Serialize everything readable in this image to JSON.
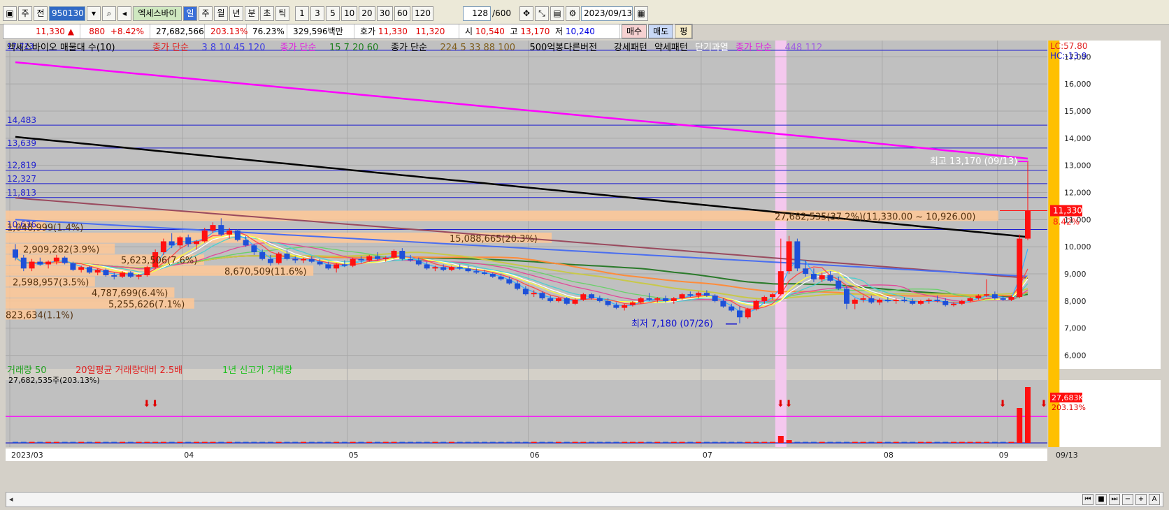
{
  "toolbar": {
    "btn_main": "주",
    "btn_prev": "전",
    "code": "950130",
    "stock_name": "엑세스바이",
    "period_tabs": [
      "일",
      "주",
      "월",
      "년",
      "분",
      "초",
      "틱"
    ],
    "period_selected": "일",
    "intervals": [
      "1",
      "3",
      "5",
      "10",
      "20",
      "30",
      "60",
      "120"
    ],
    "count": "128",
    "count_total": "/600",
    "date": "2023/09/13"
  },
  "quote": {
    "price": "11,330",
    "arrow": "▲",
    "change": "880",
    "change_pct": "+8.42%",
    "volume": "27,682,566",
    "vol_ratio": "203.13%",
    "turnover": "76.23%",
    "amount": "329,596백만",
    "hoga_label": "호가",
    "ask": "11,330",
    "bid": "11,320",
    "open_label": "시",
    "open": "10,540",
    "high_label": "고",
    "high": "13,170",
    "low_label": "저",
    "low": "10,240",
    "buy": "매수",
    "sell": "매도",
    "avg": "평"
  },
  "legend": {
    "main": "엑세스바이오 매물대 수(10)",
    "ma1_title": "종가 단순",
    "ma1_periods": [
      "3",
      "8",
      "10",
      "45",
      "120"
    ],
    "ma2_title": "종가 단순",
    "ma2_periods": [
      "15",
      "7",
      "20",
      "60"
    ],
    "ma3_title": "종가 단순",
    "ma3_periods": [
      "224",
      "5",
      "33",
      "88",
      "100"
    ],
    "extra1": "500억봉다른버전",
    "extra2": "강세패턴",
    "extra3": "약세패턴",
    "extra4": "단기과열",
    "ma4_title": "종가 단순",
    "ma4_periods": [
      "448",
      "112"
    ],
    "lc": "LC:57.80",
    "hc": "HC:-13.9",
    "top_left_value": "17,713"
  },
  "volume_legend": {
    "title": "거래량",
    "p1": "50",
    "t2": "20일평균 거래량대비 2.5배",
    "t3": "1년 신고가 거래량",
    "current": "27,682,535주(203.13%)",
    "badge_value": "27,683K",
    "badge_pct": "203.13%"
  },
  "chart_data": {
    "type": "candlestick",
    "x_tick_labels": [
      "2023/03",
      "04",
      "05",
      "06",
      "07",
      "08",
      "09",
      "09/13"
    ],
    "y_ticks": [
      6000,
      7000,
      8000,
      9000,
      10000,
      11000,
      12000,
      13000,
      14000,
      15000,
      16000,
      17000
    ],
    "ylim": [
      5500,
      17600
    ],
    "hlines": [
      {
        "label": "14,483",
        "value": 14483
      },
      {
        "label": "13,639",
        "value": 13639
      },
      {
        "label": "12,819",
        "value": 12819
      },
      {
        "label": "12,327",
        "value": 12327
      },
      {
        "label": "11,813",
        "value": 11813
      },
      {
        "label": "10,636",
        "value": 10636
      }
    ],
    "volume_profile": [
      {
        "label": "27,682,535(37.2%)(11,330.00 ~ 10,926.00)",
        "lo": 10926,
        "hi": 11330,
        "frac": 1.0
      },
      {
        "label": "1,048,999(1.4%)",
        "lo": 10522,
        "hi": 10926,
        "frac": 0.04
      },
      {
        "label": "15,088,665(20.3%)",
        "lo": 10118,
        "hi": 10522,
        "frac": 0.55
      },
      {
        "label": "2,909,282(3.9%)",
        "lo": 9714,
        "hi": 10118,
        "frac": 0.11
      },
      {
        "label": "5,623,506(7.6%)",
        "lo": 9310,
        "hi": 9714,
        "frac": 0.2
      },
      {
        "label": "8,670,509(11.6%)",
        "lo": 8906,
        "hi": 9310,
        "frac": 0.31
      },
      {
        "label": "2,598,957(3.5%)",
        "lo": 8502,
        "hi": 8906,
        "frac": 0.09
      },
      {
        "label": "4,787,699(6.4%)",
        "lo": 8098,
        "hi": 8502,
        "frac": 0.17
      },
      {
        "label": "5,255,626(7.1%)",
        "lo": 7694,
        "hi": 8098,
        "frac": 0.19
      },
      {
        "label": "823,634(1.1%)",
        "lo": 7290,
        "hi": 7694,
        "frac": 0.03
      }
    ],
    "high_annotation": "최고 13,170 (09/13)",
    "low_annotation": "최저 7,180 (07/26)",
    "last_price_label": "11,330",
    "last_pct_label": "8.42%",
    "candles": [
      [
        9900,
        10100,
        9500,
        9600
      ],
      [
        9600,
        9700,
        9100,
        9200
      ],
      [
        9200,
        9550,
        9100,
        9450
      ],
      [
        9450,
        9600,
        9300,
        9350
      ],
      [
        9350,
        9500,
        9200,
        9450
      ],
      [
        9450,
        9700,
        9350,
        9600
      ],
      [
        9600,
        9650,
        9350,
        9400
      ],
      [
        9400,
        9450,
        9100,
        9150
      ],
      [
        9150,
        9300,
        9050,
        9250
      ],
      [
        9250,
        9300,
        9000,
        9050
      ],
      [
        9050,
        9200,
        8950,
        9150
      ],
      [
        9150,
        9200,
        8900,
        8950
      ],
      [
        8950,
        9050,
        8800,
        8900
      ],
      [
        8900,
        9100,
        8850,
        9050
      ],
      [
        9050,
        9100,
        8850,
        8900
      ],
      [
        8900,
        9000,
        8800,
        8950
      ],
      [
        8950,
        9300,
        8900,
        9250
      ],
      [
        9250,
        9900,
        9200,
        9800
      ],
      [
        9800,
        10300,
        9700,
        10200
      ],
      [
        10200,
        10500,
        9950,
        10050
      ],
      [
        10050,
        10400,
        9950,
        10350
      ],
      [
        10350,
        10450,
        10000,
        10100
      ],
      [
        10100,
        10250,
        9900,
        10200
      ],
      [
        10200,
        10700,
        10150,
        10600
      ],
      [
        10600,
        10900,
        10500,
        10800
      ],
      [
        10800,
        11050,
        10400,
        10450
      ],
      [
        10450,
        10700,
        10300,
        10600
      ],
      [
        10600,
        10650,
        10200,
        10250
      ],
      [
        10250,
        10400,
        10000,
        10050
      ],
      [
        10050,
        10100,
        9700,
        9800
      ],
      [
        9800,
        9900,
        9500,
        9550
      ],
      [
        9550,
        9700,
        9300,
        9400
      ],
      [
        9400,
        9800,
        9350,
        9750
      ],
      [
        9750,
        9900,
        9500,
        9550
      ],
      [
        9550,
        9650,
        9400,
        9500
      ],
      [
        9500,
        9600,
        9400,
        9550
      ],
      [
        9550,
        9650,
        9400,
        9450
      ],
      [
        9450,
        9550,
        9300,
        9350
      ],
      [
        9350,
        9450,
        9150,
        9200
      ],
      [
        9200,
        9400,
        9050,
        9350
      ],
      [
        9350,
        9500,
        9250,
        9300
      ],
      [
        9300,
        9600,
        9250,
        9550
      ],
      [
        9550,
        9650,
        9400,
        9500
      ],
      [
        9500,
        9700,
        9450,
        9650
      ],
      [
        9650,
        9800,
        9500,
        9550
      ],
      [
        9550,
        9650,
        9450,
        9600
      ],
      [
        9600,
        9900,
        9550,
        9850
      ],
      [
        9850,
        9950,
        9500,
        9550
      ],
      [
        9550,
        9700,
        9450,
        9500
      ],
      [
        9500,
        9600,
        9300,
        9350
      ],
      [
        9350,
        9450,
        9150,
        9200
      ],
      [
        9200,
        9300,
        9100,
        9250
      ],
      [
        9250,
        9350,
        9100,
        9150
      ],
      [
        9150,
        9300,
        9100,
        9250
      ],
      [
        9250,
        9350,
        9150,
        9200
      ],
      [
        9200,
        9300,
        9050,
        9100
      ],
      [
        9100,
        9200,
        9000,
        9050
      ],
      [
        9050,
        9150,
        8950,
        9000
      ],
      [
        9000,
        9050,
        8850,
        8900
      ],
      [
        8900,
        9000,
        8750,
        8800
      ],
      [
        8800,
        8900,
        8600,
        8650
      ],
      [
        8650,
        8750,
        8400,
        8450
      ],
      [
        8450,
        8550,
        8200,
        8250
      ],
      [
        8250,
        8400,
        8150,
        8300
      ],
      [
        8300,
        8350,
        8050,
        8100
      ],
      [
        8100,
        8200,
        7950,
        8000
      ],
      [
        8000,
        8150,
        7950,
        8100
      ],
      [
        8100,
        8150,
        7850,
        7900
      ],
      [
        7900,
        8100,
        7850,
        8050
      ],
      [
        8050,
        8300,
        8000,
        8250
      ],
      [
        8250,
        8300,
        8050,
        8100
      ],
      [
        8100,
        8200,
        7950,
        8000
      ],
      [
        8000,
        8100,
        7800,
        7850
      ],
      [
        7850,
        7950,
        7700,
        7750
      ],
      [
        7750,
        7900,
        7650,
        7850
      ],
      [
        7850,
        8000,
        7800,
        7950
      ],
      [
        7950,
        8150,
        7900,
        8100
      ],
      [
        8100,
        8300,
        8000,
        8050
      ],
      [
        8050,
        8150,
        7950,
        8100
      ],
      [
        8100,
        8200,
        7950,
        8000
      ],
      [
        8000,
        8150,
        7900,
        8100
      ],
      [
        8100,
        8300,
        8050,
        8250
      ],
      [
        8250,
        8350,
        8150,
        8200
      ],
      [
        8200,
        8350,
        8100,
        8300
      ],
      [
        8300,
        8400,
        8150,
        8200
      ],
      [
        8200,
        8250,
        7950,
        8000
      ],
      [
        8000,
        8100,
        7750,
        7800
      ],
      [
        7800,
        7900,
        7600,
        7650
      ],
      [
        7650,
        7800,
        7180,
        7400
      ],
      [
        7400,
        7750,
        7350,
        7700
      ],
      [
        7700,
        8050,
        7650,
        8000
      ],
      [
        8000,
        8200,
        7900,
        8150
      ],
      [
        8150,
        8300,
        8050,
        8250
      ],
      [
        8250,
        10300,
        8200,
        9100
      ],
      [
        9100,
        10400,
        9000,
        10200
      ],
      [
        10200,
        10300,
        9100,
        9200
      ],
      [
        9200,
        9500,
        8900,
        9000
      ],
      [
        9000,
        9200,
        8700,
        8800
      ],
      [
        8800,
        9050,
        8700,
        8950
      ],
      [
        8950,
        9100,
        8700,
        8750
      ],
      [
        8750,
        8900,
        8400,
        8450
      ],
      [
        8450,
        8550,
        7700,
        7900
      ],
      [
        7900,
        8100,
        7700,
        8050
      ],
      [
        8050,
        8200,
        7950,
        8100
      ],
      [
        8100,
        8200,
        7900,
        7950
      ],
      [
        7950,
        8100,
        7850,
        8050
      ],
      [
        8050,
        8150,
        7950,
        8000
      ],
      [
        8000,
        8100,
        7900,
        8050
      ],
      [
        8050,
        8150,
        7950,
        8000
      ],
      [
        8000,
        8100,
        7850,
        7900
      ],
      [
        7900,
        8050,
        7850,
        8000
      ],
      [
        8000,
        8100,
        7900,
        8050
      ],
      [
        8050,
        8200,
        7950,
        8000
      ],
      [
        8000,
        8100,
        7800,
        7850
      ],
      [
        7850,
        7950,
        7800,
        7900
      ],
      [
        7900,
        8050,
        7850,
        8000
      ],
      [
        8000,
        8150,
        7950,
        8100
      ],
      [
        8100,
        8250,
        8050,
        8200
      ],
      [
        8200,
        8800,
        8150,
        8250
      ],
      [
        8250,
        8350,
        8050,
        8100
      ],
      [
        8100,
        8200,
        8000,
        8050
      ],
      [
        8050,
        8200,
        8000,
        8150
      ],
      [
        8150,
        10450,
        8100,
        10300
      ],
      [
        10300,
        13170,
        10240,
        11330
      ]
    ]
  }
}
